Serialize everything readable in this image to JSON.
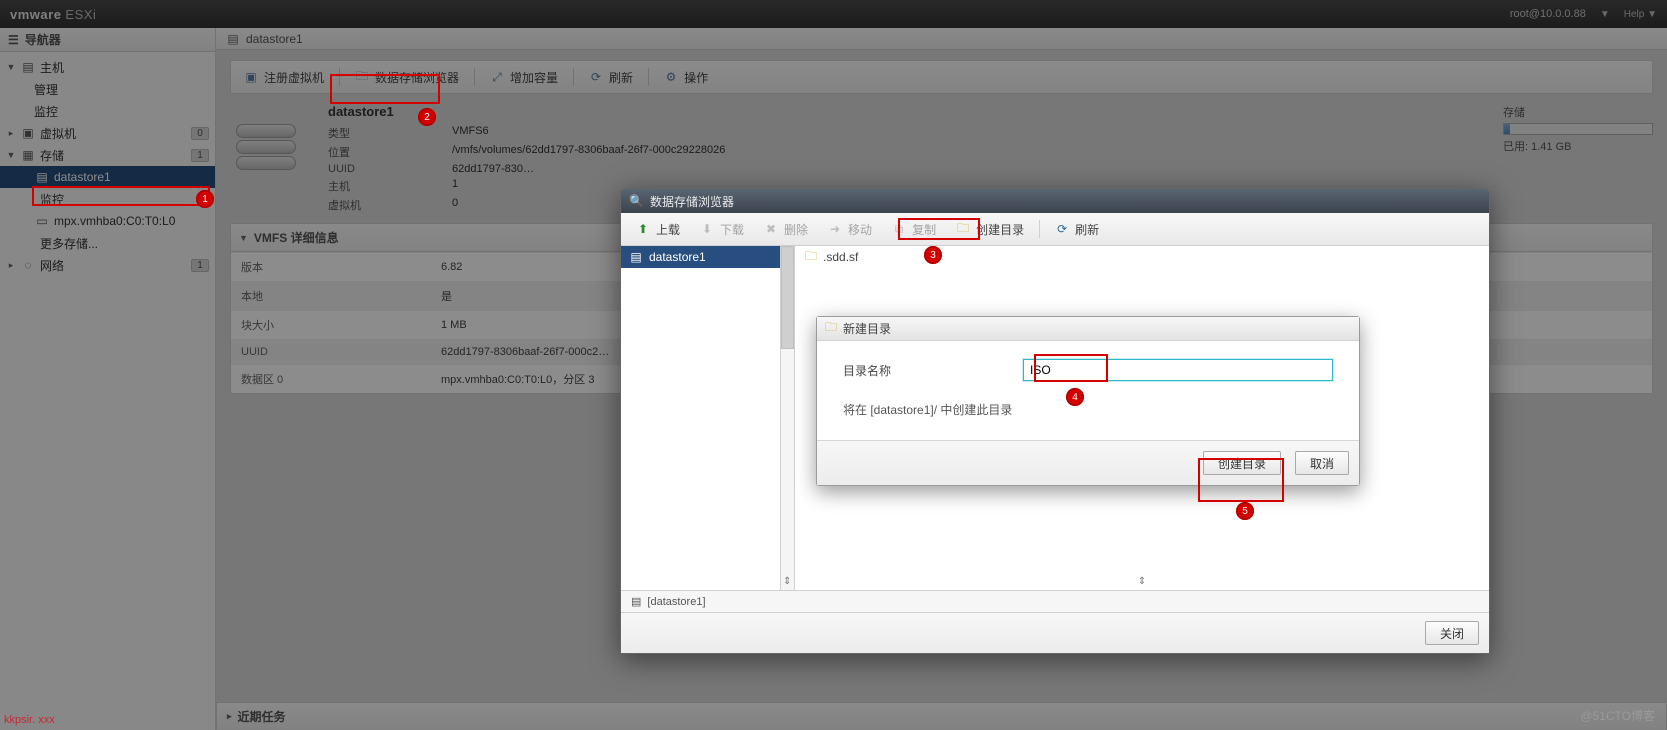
{
  "brand": {
    "main": "vmware",
    "sub": "ESXi"
  },
  "user": "root@10.0.0.88",
  "nav": {
    "title": "导航器",
    "host": {
      "label": "主机",
      "children": [
        {
          "label": "管理"
        },
        {
          "label": "监控"
        }
      ]
    },
    "vm": {
      "label": "虚拟机",
      "count": "0"
    },
    "storage": {
      "label": "存储",
      "count": "1",
      "children": [
        {
          "label": "datastore1",
          "selected": true
        },
        {
          "label": "监控"
        },
        {
          "label": "mpx.vmhba0:C0:T0:L0"
        },
        {
          "label": "更多存储..."
        }
      ]
    },
    "network": {
      "label": "网络",
      "count": "1"
    }
  },
  "crumb": {
    "label": "datastore1"
  },
  "toolbar": {
    "register": "注册虚拟机",
    "browser": "数据存储浏览器",
    "extend": "增加容量",
    "refresh": "刷新",
    "actions": "操作"
  },
  "summary": {
    "title": "datastore1",
    "rows": {
      "type": {
        "k": "类型",
        "v": "VMFS6"
      },
      "location": {
        "k": "位置",
        "v": "/vmfs/volumes/62dd1797-8306baaf-26f7-000c29228026"
      },
      "uuid": {
        "k": "UUID",
        "v": "62dd1797-830…"
      },
      "hosts": {
        "k": "主机",
        "v": "1"
      },
      "vms": {
        "k": "虚拟机",
        "v": "0"
      }
    },
    "storage": {
      "label": "存储",
      "used": "已用: 1.41 GB"
    }
  },
  "vmfs": {
    "header": "VMFS 详细信息",
    "rows": [
      {
        "k": "版本",
        "v": "6.82"
      },
      {
        "k": "本地",
        "v": "是"
      },
      {
        "k": "块大小",
        "v": "1 MB"
      },
      {
        "k": "UUID",
        "v": "62dd1797-8306baaf-26f7-000c2…"
      },
      {
        "k": "数据区 0",
        "v": "mpx.vmhba0:C0:T0:L0，分区 3"
      }
    ]
  },
  "tasks": {
    "header": "近期任务"
  },
  "browser": {
    "title": "数据存储浏览器",
    "tb": {
      "upload": "上载",
      "download": "下载",
      "delete": "删除",
      "move": "移动",
      "copy": "复制",
      "mkdir": "创建目录",
      "refresh": "刷新"
    },
    "tree_item": "datastore1",
    "list_item": ".sdd.sf",
    "status": "[datastore1]",
    "close": "关闭"
  },
  "mkdir": {
    "title": "新建目录",
    "label": "目录名称",
    "value": "ISO",
    "hint": "将在 [datastore1]/ 中创建此目录",
    "ok": "创建目录",
    "cancel": "取消"
  },
  "watermark": "@51CTO博客",
  "watermark_left": "kkpsir. xxx",
  "callouts": {
    "1": "1",
    "2": "2",
    "3": "3",
    "4": "4",
    "5": "5"
  }
}
